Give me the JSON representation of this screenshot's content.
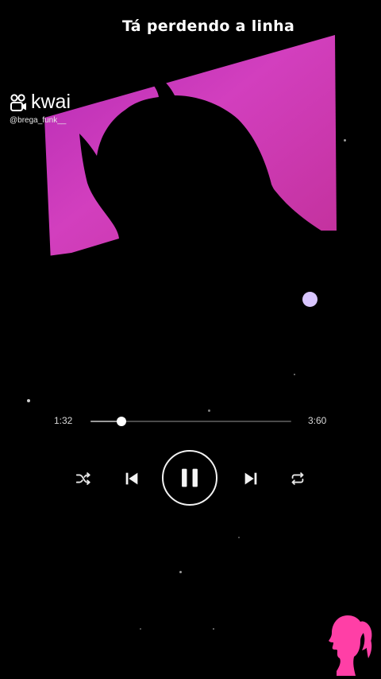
{
  "caption": {
    "text": "Tá perdendo a linha"
  },
  "watermark": {
    "brand": "kwai",
    "handle": "@brega_funk__",
    "icon": "kwai-logo-icon"
  },
  "player": {
    "current_time": "1:32",
    "total_time": "3:60",
    "progress": 0.155,
    "controls": {
      "shuffle_icon": "shuffle-icon",
      "previous_icon": "skip-previous-icon",
      "play_pause_icon": "pause-icon",
      "next_icon": "skip-next-icon",
      "repeat_icon": "repeat-icon"
    }
  },
  "corner_logo": {
    "icon": "barbie-head-icon",
    "color": "#ff3fa6"
  },
  "colors": {
    "accent_pink": "#e040c0",
    "background": "#000000",
    "dot_lilac": "#d9c6ff"
  }
}
